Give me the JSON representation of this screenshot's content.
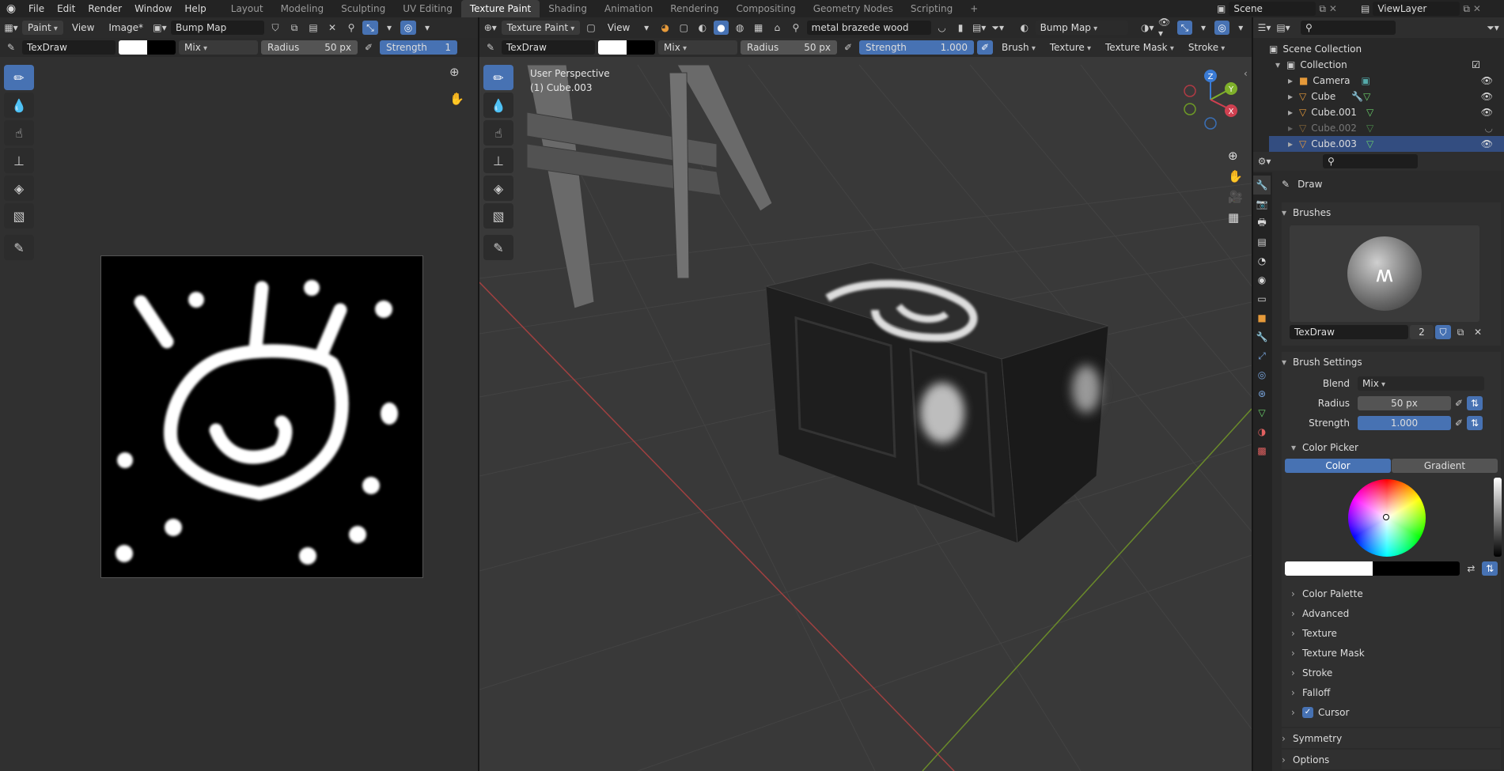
{
  "topbar": {
    "menus": [
      "File",
      "Edit",
      "Render",
      "Window",
      "Help"
    ],
    "workspaces": [
      "Layout",
      "Modeling",
      "Sculpting",
      "UV Editing",
      "Texture Paint",
      "Shading",
      "Animation",
      "Rendering",
      "Compositing",
      "Geometry Nodes",
      "Scripting"
    ],
    "active_workspace": "Texture Paint",
    "scene": "Scene",
    "view_layer": "ViewLayer"
  },
  "image_editor": {
    "mode": "Paint",
    "view_menu": "View",
    "image_menu": "Image*",
    "image_name": "Bump Map",
    "brush_name": "TexDraw",
    "blend": "Mix",
    "radius_label": "Radius",
    "radius_value": "50 px",
    "strength_label": "Strength",
    "strength_value": "1"
  },
  "viewport": {
    "mode": "Texture Paint",
    "view_menu": "View",
    "search_text": "metal brazede wood",
    "image_name": "Bump Map",
    "brush_name": "TexDraw",
    "blend": "Mix",
    "radius_label": "Radius",
    "radius_value": "50 px",
    "strength_label": "Strength",
    "strength_value": "1.000",
    "menus": [
      "Brush",
      "Texture",
      "Texture Mask",
      "Stroke"
    ],
    "overlay_line1": "User Perspective",
    "overlay_line2": "(1) Cube.003",
    "gizmo": {
      "x": "X",
      "y": "Y",
      "z": "Z"
    }
  },
  "outliner": {
    "root": "Scene Collection",
    "collection": "Collection",
    "items": [
      {
        "name": "Camera",
        "dim": false
      },
      {
        "name": "Cube",
        "dim": false
      },
      {
        "name": "Cube.001",
        "dim": false
      },
      {
        "name": "Cube.002",
        "dim": true
      },
      {
        "name": "Cube.003",
        "dim": false
      }
    ]
  },
  "properties": {
    "tool_name": "Draw",
    "brushes_header": "Brushes",
    "brush_name": "TexDraw",
    "brush_users": "2",
    "brush_settings_header": "Brush Settings",
    "blend_label": "Blend",
    "blend_value": "Mix",
    "radius_label": "Radius",
    "radius_value": "50 px",
    "strength_label": "Strength",
    "strength_value": "1.000",
    "color_picker_header": "Color Picker",
    "color_tab": "Color",
    "gradient_tab": "Gradient",
    "sections": [
      "Color Palette",
      "Advanced",
      "Texture",
      "Texture Mask",
      "Stroke",
      "Falloff"
    ],
    "cursor_label": "Cursor",
    "symmetry_header": "Symmetry",
    "options_header": "Options"
  }
}
